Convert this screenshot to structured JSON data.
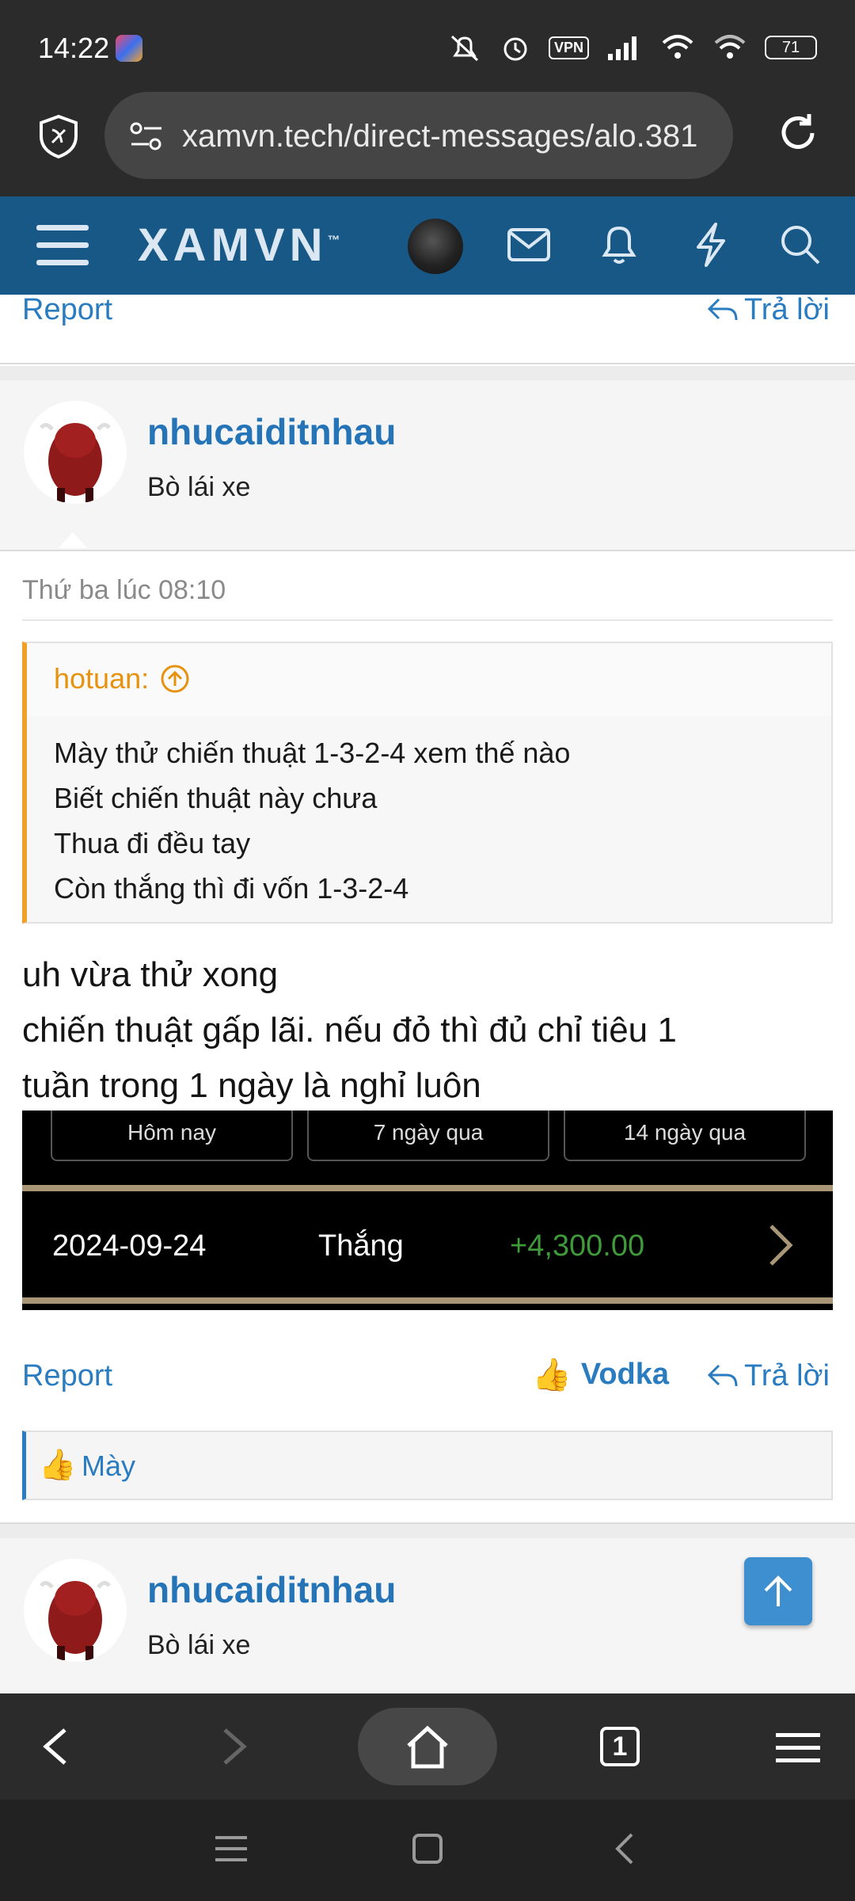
{
  "status_bar": {
    "time": "14:22",
    "vpn": "VPN",
    "battery": "71"
  },
  "browser": {
    "url": "xamvn.tech/direct-messages/alo.381",
    "tab_count": "1"
  },
  "site": {
    "logo": "XAMVN",
    "logo_tm": "™"
  },
  "prev_post": {
    "report": "Report",
    "reply": "Trả lời"
  },
  "post": {
    "username": "nhucaiditnhau",
    "user_title": "Bò lái xe",
    "timestamp": "Thứ ba lúc 08:10",
    "quote_author": "hotuan:",
    "quote_lines": [
      "Mày thử chiến thuật 1-3-2-4 xem thế nào",
      "Biết chiến thuật này chưa",
      "Thua đi đều tay",
      "Còn thắng thì đi vốn 1-3-2-4"
    ],
    "body_lines": [
      "uh vừa thử xong",
      "chiến thuật gấp lãi. nếu đỏ thì đủ chỉ tiêu 1",
      "tuần trong 1 ngày là nghỉ luôn"
    ],
    "screenshot": {
      "tabs": [
        "Hôm nay",
        "7 ngày qua",
        "14 ngày qua"
      ],
      "date": "2024-09-24",
      "result": "Thắng",
      "amount": "+4,300.00"
    },
    "report": "Report",
    "like_label": "Vodka",
    "reply": "Trả lời",
    "reaction_user": "Mày"
  },
  "next_post": {
    "username": "nhucaiditnhau",
    "user_title": "Bò lái xe"
  },
  "colors": {
    "brand": "#185886",
    "link": "#2a7cc1",
    "quote_accent": "#f0a02a",
    "win_green": "#3f9a3a"
  }
}
